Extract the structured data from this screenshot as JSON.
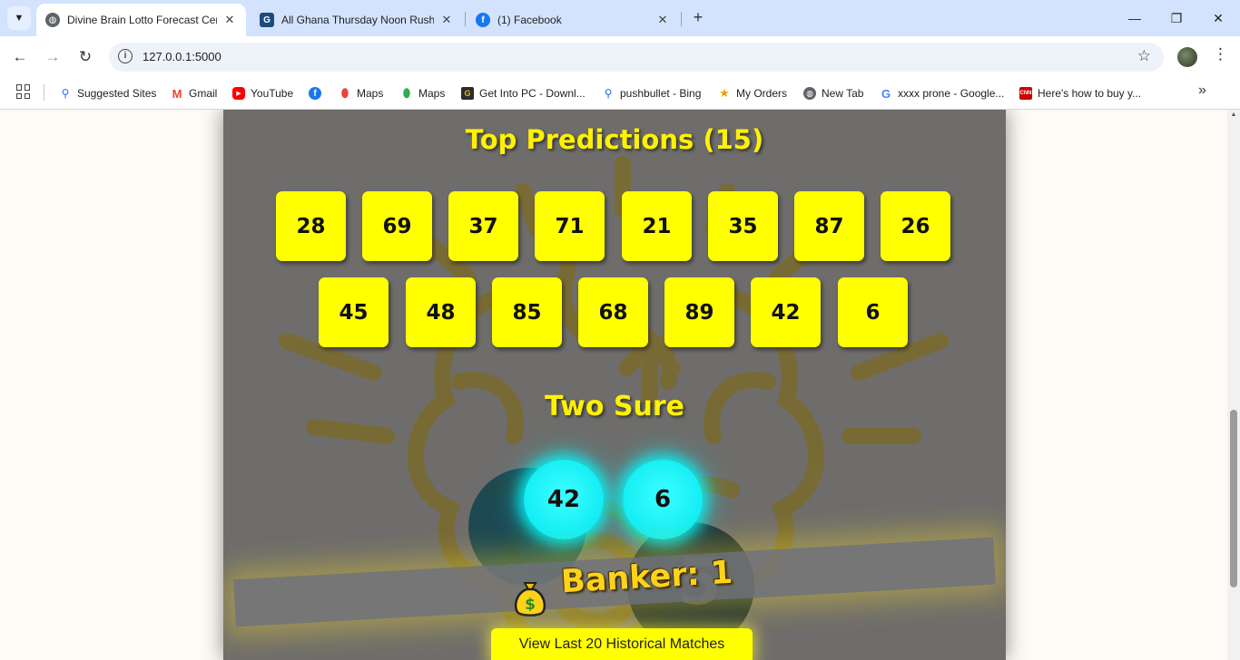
{
  "browser": {
    "tabs": [
      {
        "title": "Divine Brain Lotto Forecast Cen",
        "active": true,
        "favicon": "globe-icon"
      },
      {
        "title": "All Ghana Thursday Noon Rush",
        "active": false,
        "favicon": "gn-icon"
      },
      {
        "title": "(1) Facebook",
        "active": false,
        "favicon": "facebook-icon"
      }
    ],
    "tab_close_glyph": "✕",
    "new_tab_glyph": "+",
    "address": "127.0.0.1:5000",
    "bookmarks": [
      {
        "label": "Suggested Sites",
        "icon": "search-icon"
      },
      {
        "label": "Gmail",
        "icon": "gmail-icon"
      },
      {
        "label": "YouTube",
        "icon": "youtube-icon"
      },
      {
        "label": "",
        "icon": "facebook-icon"
      },
      {
        "label": "Maps",
        "icon": "maps-pin-icon"
      },
      {
        "label": "Maps",
        "icon": "maps-pin-icon"
      },
      {
        "label": "Get Into PC - Downl...",
        "icon": "getintopc-icon"
      },
      {
        "label": "pushbullet - Bing",
        "icon": "search-icon"
      },
      {
        "label": "My Orders",
        "icon": "star-badge-icon"
      },
      {
        "label": "New Tab",
        "icon": "globe-icon"
      },
      {
        "label": "xxxx prone - Google...",
        "icon": "google-icon"
      },
      {
        "label": "Here's how to buy y...",
        "icon": "cnn-icon"
      }
    ],
    "bookmarks_more_glyph": "»"
  },
  "page": {
    "top_predictions": {
      "title": "Top Predictions (15)",
      "numbers": [
        "28",
        "69",
        "37",
        "71",
        "21",
        "35",
        "87",
        "26",
        "45",
        "48",
        "85",
        "68",
        "89",
        "42",
        "6"
      ]
    },
    "two_sure": {
      "title": "Two Sure",
      "numbers": [
        "42",
        "6"
      ]
    },
    "banker": {
      "label": "Banker: 1"
    },
    "history_button": "View Last 20 Historical Matches"
  },
  "colors": {
    "number_tile": "#ffff00",
    "sure_ball": "#00f0f8",
    "title_text": "#fff200",
    "banker_text": "#ffd21a",
    "panel": "#6e6d6b",
    "tab_strip": "#d3e3fd"
  }
}
